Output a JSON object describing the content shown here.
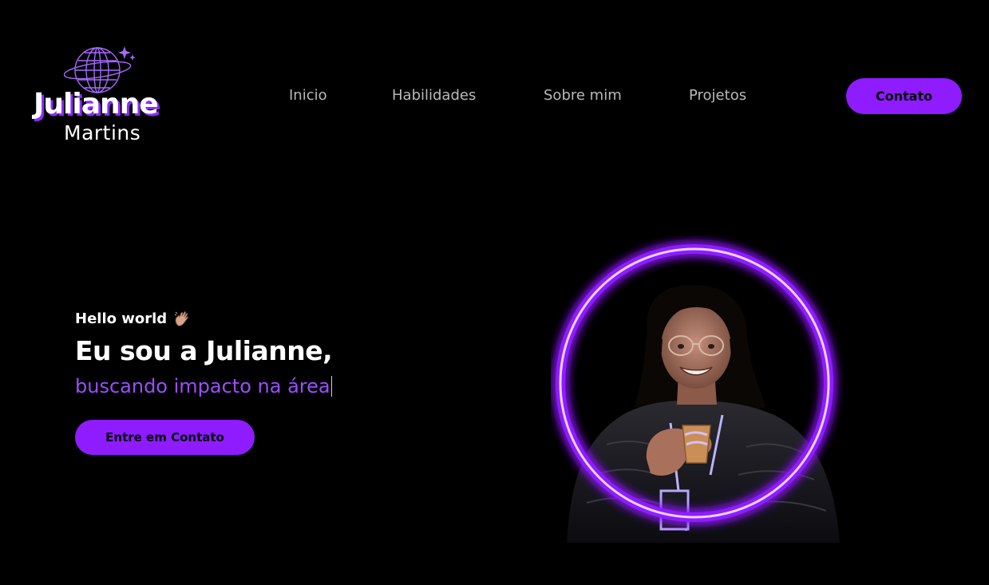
{
  "logo": {
    "first_name": "Julianne",
    "last_name": "Martins",
    "icon": "planet-globe-icon"
  },
  "nav": {
    "items": [
      "Inicio",
      "Habilidades",
      "Sobre mim",
      "Projetos"
    ]
  },
  "header": {
    "contact_label": "Contato"
  },
  "hero": {
    "greeting": "Hello world",
    "greeting_icon": "waving-hand-icon",
    "headline": "Eu sou a Julianne,",
    "subline": "buscando impacto na área",
    "cta_label": "Entre em Contato",
    "photo": "profile-photo"
  },
  "colors": {
    "background": "#000000",
    "accent": "#8e1cff",
    "accent_text": "#9b4dff",
    "nav_text": "#b9b9b9",
    "text": "#ffffff"
  }
}
